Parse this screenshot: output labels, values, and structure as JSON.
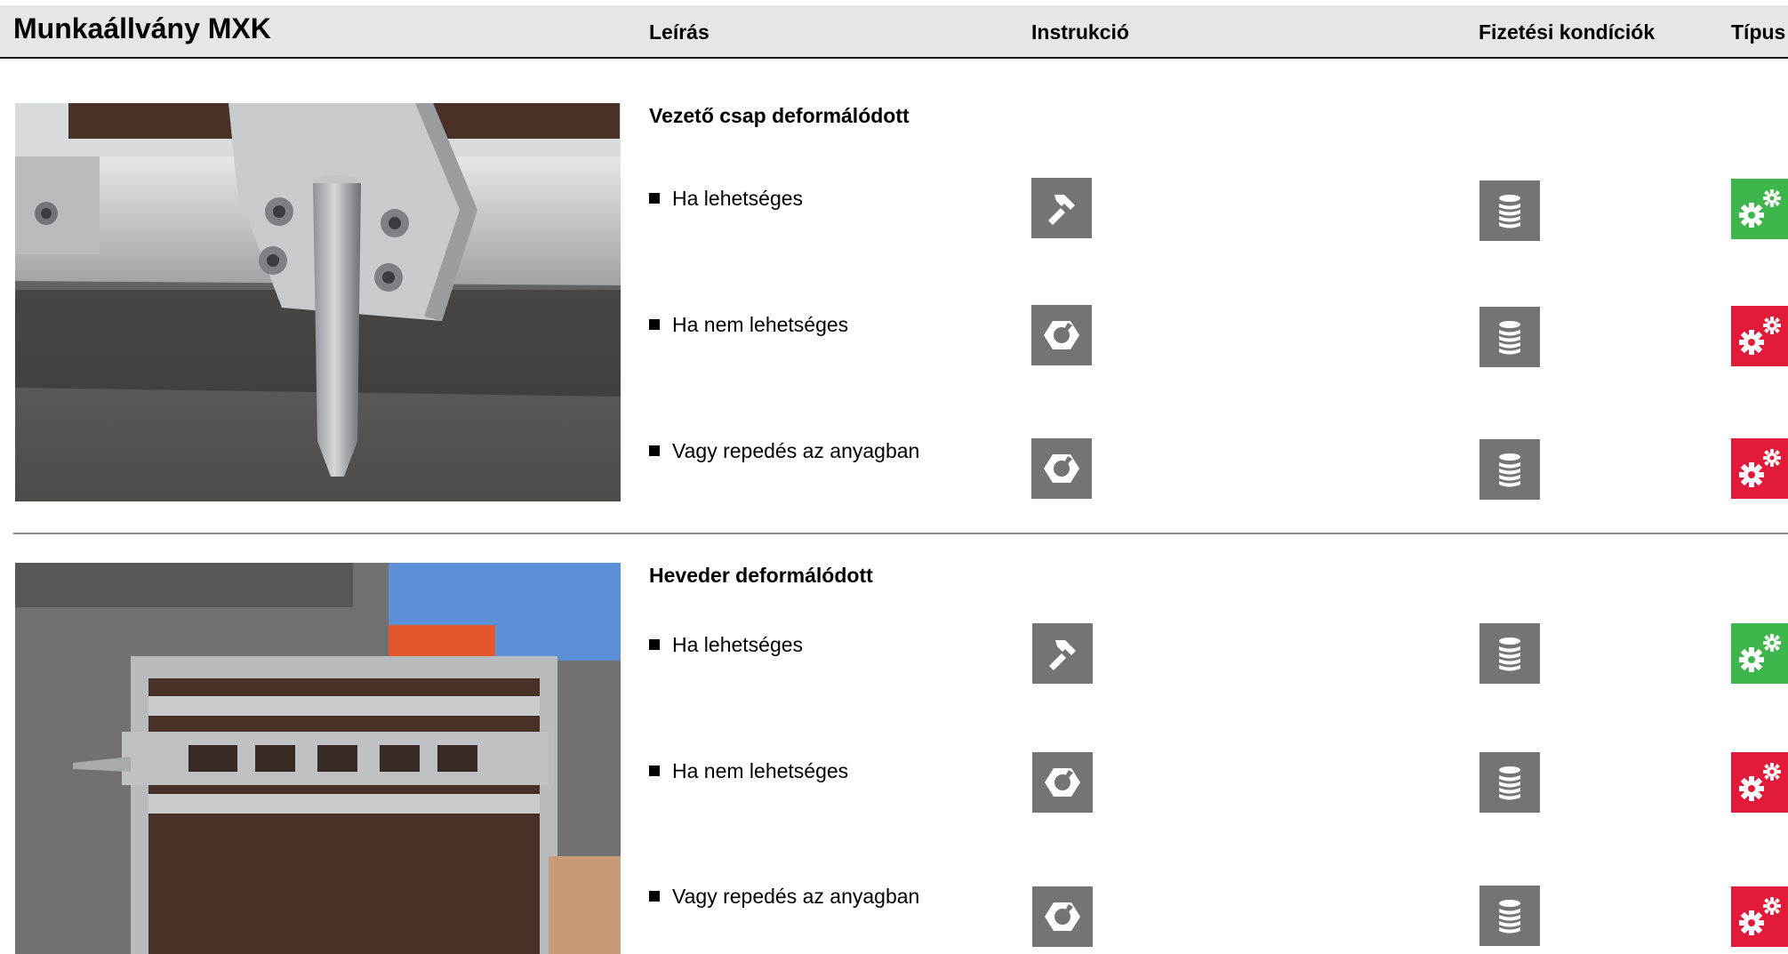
{
  "header": {
    "title": "Munkaállvány MXK",
    "col_description": "Leírás",
    "col_instruction": "Instrukció",
    "col_payment": "Fizetési kondíciók",
    "col_type": "Típus"
  },
  "sections": [
    {
      "title": "Vezető csap deformálódott",
      "items": [
        {
          "label": "Ha lehetséges",
          "instruction_icon": "hammer-icon",
          "payment_icon": "coins-stack-icon",
          "type_icon": "gears-icon",
          "type_color": "#3db64b"
        },
        {
          "label": "Ha nem lehetséges",
          "instruction_icon": "broken-nut-icon",
          "payment_icon": "coins-stack-icon",
          "type_icon": "gears-icon",
          "type_color": "#e31b3a"
        },
        {
          "label": "Vagy repedés az anyagban",
          "instruction_icon": "broken-nut-icon",
          "payment_icon": "coins-stack-icon",
          "type_icon": "gears-icon",
          "type_color": "#e31b3a"
        }
      ]
    },
    {
      "title": "Heveder deformálódott",
      "items": [
        {
          "label": "Ha lehetséges",
          "instruction_icon": "hammer-icon",
          "payment_icon": "coins-stack-icon",
          "type_icon": "gears-icon",
          "type_color": "#3db64b"
        },
        {
          "label": "Ha nem lehetséges",
          "instruction_icon": "broken-nut-icon",
          "payment_icon": "coins-stack-icon",
          "type_icon": "gears-icon",
          "type_color": "#e31b3a"
        },
        {
          "label": "Vagy repedés az anyagban",
          "instruction_icon": "broken-nut-icon",
          "payment_icon": "coins-stack-icon",
          "type_icon": "gears-icon",
          "type_color": "#e31b3a"
        }
      ]
    }
  ]
}
